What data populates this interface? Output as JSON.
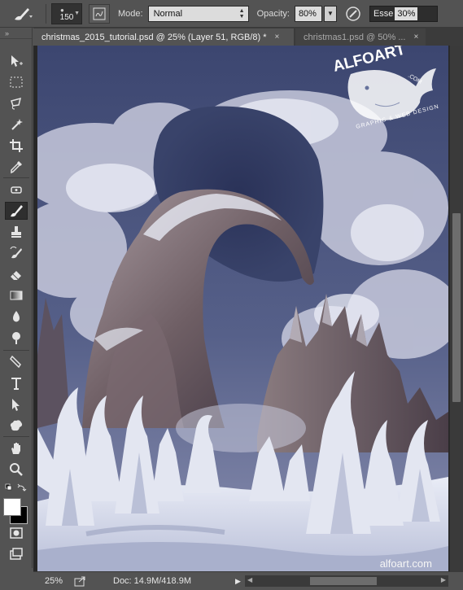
{
  "options_bar": {
    "brush_size": "150",
    "mode_label": "Mode:",
    "mode_value": "Normal",
    "opacity_label": "Opacity:",
    "opacity_value": "80%",
    "flow_label": "Esse",
    "flow_value": "30%"
  },
  "tabs": [
    {
      "label": "christmas_2015_tutorial.psd @ 25% (Layer 51, RGB/8) *",
      "close": "×"
    },
    {
      "label": "christmas1.psd @ 50% ...",
      "close": "×"
    }
  ],
  "artwork": {
    "logo_text": "ALFOART",
    "logo_tagline": "GRAPHIC & WEB DESIGN",
    "logo_small": ".COM",
    "watermark": "alfoart.com"
  },
  "status_bar": {
    "zoom": "25%",
    "doc_info": "Doc: 14.9M/418.9M",
    "arrow": "▶"
  },
  "tools": [
    "move-tool",
    "rectangular-marquee-tool",
    "lasso-tool",
    "magic-wand-tool",
    "crop-tool",
    "eyedropper-tool",
    "spot-healing-tool",
    "brush-tool",
    "clone-stamp-tool",
    "history-brush-tool",
    "eraser-tool",
    "gradient-tool",
    "blur-tool",
    "dodge-tool",
    "pen-tool",
    "type-tool",
    "path-selection-tool",
    "custom-shape-tool",
    "hand-tool",
    "zoom-tool"
  ],
  "colors": {
    "foreground": "#ffffff",
    "background": "#000000",
    "ui_bg": "#535353",
    "sky": "#3d4a6e"
  }
}
